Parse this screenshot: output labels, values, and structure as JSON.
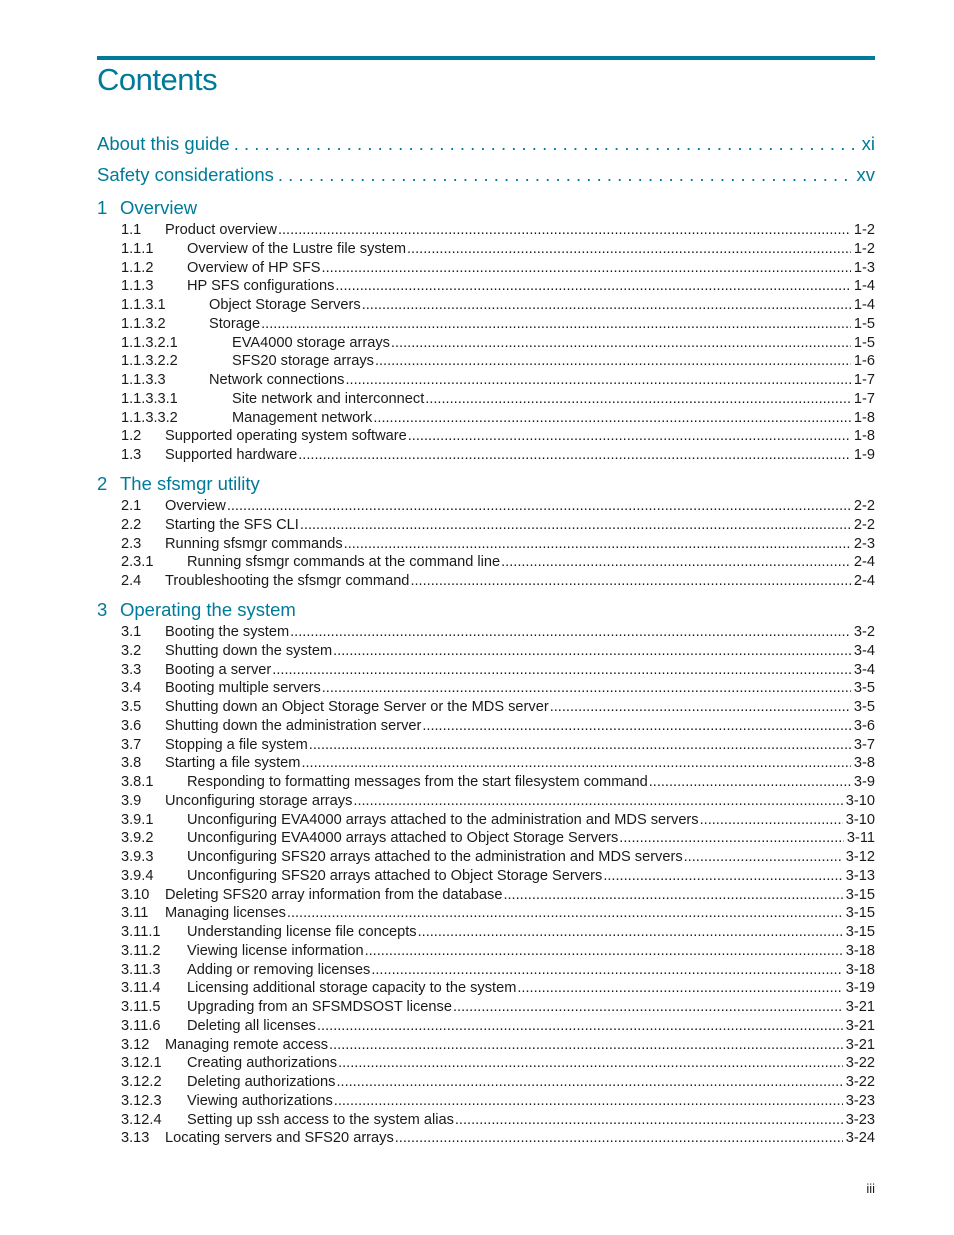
{
  "page": {
    "title": "Contents",
    "accent_color": "#007a99",
    "folio": "iii"
  },
  "front_matter": [
    {
      "text": "About this guide",
      "page": "xi"
    },
    {
      "text": "Safety considerations",
      "page": "xv"
    }
  ],
  "chapters": [
    {
      "number": "1",
      "title": "Overview",
      "entries": [
        {
          "num": "1.1",
          "text": "Product overview",
          "page": "1-2",
          "level": 1
        },
        {
          "num": "1.1.1",
          "text": "Overview of the Lustre file system",
          "page": "1-2",
          "level": 2
        },
        {
          "num": "1.1.2",
          "text": "Overview of HP SFS",
          "page": "1-3",
          "level": 2
        },
        {
          "num": "1.1.3",
          "text": "HP SFS configurations",
          "page": "1-4",
          "level": 2
        },
        {
          "num": "1.1.3.1",
          "text": "Object Storage Servers",
          "page": "1-4",
          "level": 3
        },
        {
          "num": "1.1.3.2",
          "text": "Storage",
          "page": "1-5",
          "level": 3
        },
        {
          "num": "1.1.3.2.1",
          "text": "EVA4000 storage arrays",
          "page": "1-5",
          "level": 4
        },
        {
          "num": "1.1.3.2.2",
          "text": "SFS20 storage arrays",
          "page": "1-6",
          "level": 4
        },
        {
          "num": "1.1.3.3",
          "text": "Network connections",
          "page": "1-7",
          "level": 3
        },
        {
          "num": "1.1.3.3.1",
          "text": "Site network and interconnect",
          "page": "1-7",
          "level": 4
        },
        {
          "num": "1.1.3.3.2",
          "text": "Management network",
          "page": "1-8",
          "level": 4
        },
        {
          "num": "1.2",
          "text": "Supported operating system software",
          "page": "1-8",
          "level": 1
        },
        {
          "num": "1.3",
          "text": "Supported hardware",
          "page": "1-9",
          "level": 1
        }
      ]
    },
    {
      "number": "2",
      "title": "The sfsmgr utility",
      "entries": [
        {
          "num": "2.1",
          "text": "Overview",
          "page": "2-2",
          "level": 1
        },
        {
          "num": "2.2",
          "text": "Starting the SFS CLI",
          "page": "2-2",
          "level": 1
        },
        {
          "num": "2.3",
          "text": "Running sfsmgr commands",
          "page": "2-3",
          "level": 1
        },
        {
          "num": "2.3.1",
          "text": "Running sfsmgr commands at the command line",
          "page": "2-4",
          "level": 2
        },
        {
          "num": "2.4",
          "text": "Troubleshooting the sfsmgr command",
          "page": "2-4",
          "level": 1
        }
      ]
    },
    {
      "number": "3",
      "title": "Operating the system",
      "entries": [
        {
          "num": "3.1",
          "text": "Booting the system",
          "page": "3-2",
          "level": 1
        },
        {
          "num": "3.2",
          "text": "Shutting down the system",
          "page": "3-4",
          "level": 1
        },
        {
          "num": "3.3",
          "text": "Booting a server",
          "page": "3-4",
          "level": 1
        },
        {
          "num": "3.4",
          "text": "Booting multiple servers",
          "page": "3-5",
          "level": 1
        },
        {
          "num": "3.5",
          "text": "Shutting down an Object Storage Server or the MDS server",
          "page": "3-5",
          "level": 1
        },
        {
          "num": "3.6",
          "text": "Shutting down the administration server",
          "page": "3-6",
          "level": 1
        },
        {
          "num": "3.7",
          "text": "Stopping a file system",
          "page": "3-7",
          "level": 1
        },
        {
          "num": "3.8",
          "text": "Starting a file system",
          "page": "3-8",
          "level": 1
        },
        {
          "num": "3.8.1",
          "text": "Responding to formatting messages from the start filesystem command",
          "page": "3-9",
          "level": 2
        },
        {
          "num": "3.9",
          "text": "Unconfiguring storage arrays",
          "page": "3-10",
          "level": 1
        },
        {
          "num": "3.9.1",
          "text": "Unconfiguring EVA4000 arrays attached to the administration and MDS servers",
          "page": "3-10",
          "level": 2
        },
        {
          "num": "3.9.2",
          "text": "Unconfiguring EVA4000 arrays attached to Object Storage Servers",
          "page": "3-11",
          "level": 2
        },
        {
          "num": "3.9.3",
          "text": "Unconfiguring SFS20 arrays attached to the administration and MDS servers",
          "page": "3-12",
          "level": 2
        },
        {
          "num": "3.9.4",
          "text": "Unconfiguring SFS20 arrays attached to Object Storage Servers",
          "page": "3-13",
          "level": 2
        },
        {
          "num": "3.10",
          "text": "Deleting SFS20 array information from the database",
          "page": "3-15",
          "level": 1
        },
        {
          "num": "3.11",
          "text": "Managing licenses",
          "page": "3-15",
          "level": 1
        },
        {
          "num": "3.11.1",
          "text": "Understanding license file concepts",
          "page": "3-15",
          "level": 2
        },
        {
          "num": "3.11.2",
          "text": "Viewing license information",
          "page": "3-18",
          "level": 2
        },
        {
          "num": "3.11.3",
          "text": "Adding or removing licenses",
          "page": "3-18",
          "level": 2
        },
        {
          "num": "3.11.4",
          "text": "Licensing additional storage capacity to the system",
          "page": "3-19",
          "level": 2
        },
        {
          "num": "3.11.5",
          "text": "Upgrading from an SFSMDSOST license",
          "page": "3-21",
          "level": 2
        },
        {
          "num": "3.11.6",
          "text": "Deleting all licenses",
          "page": "3-21",
          "level": 2
        },
        {
          "num": "3.12",
          "text": "Managing remote access",
          "page": "3-21",
          "level": 1
        },
        {
          "num": "3.12.1",
          "text": "Creating authorizations",
          "page": "3-22",
          "level": 2
        },
        {
          "num": "3.12.2",
          "text": "Deleting authorizations",
          "page": "3-22",
          "level": 2
        },
        {
          "num": "3.12.3",
          "text": "Viewing authorizations",
          "page": "3-23",
          "level": 2
        },
        {
          "num": "3.12.4",
          "text": "Setting up ssh access to the system alias",
          "page": "3-23",
          "level": 2
        },
        {
          "num": "3.13",
          "text": "Locating servers and SFS20 arrays",
          "page": "3-24",
          "level": 1
        }
      ]
    }
  ]
}
